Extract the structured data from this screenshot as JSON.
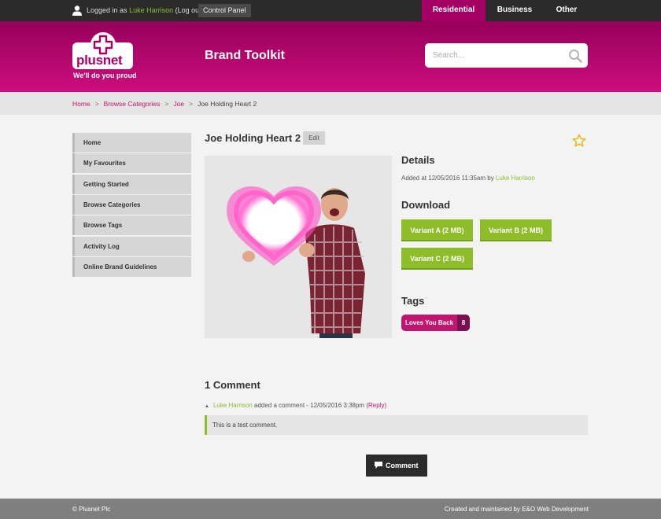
{
  "topbar": {
    "logged_in_prefix": "Logged in as",
    "username": "Luke Harrison",
    "logout": "(Log out)",
    "control_panel": "Control Panel",
    "nav": [
      "Residential",
      "Business",
      "Other"
    ],
    "active_nav": "Residential"
  },
  "header": {
    "logo_word": "plusnet",
    "logo_tagline": "We'll do you proud",
    "title": "Brand Toolkit",
    "search_placeholder": "Search..."
  },
  "breadcrumb": [
    "Home",
    "Browse Categories",
    "Joe",
    "Joe Holding Heart 2"
  ],
  "sidebar": {
    "items": [
      "Home",
      "My Favourites",
      "Getting Started",
      "Browse Categories",
      "Browse Tags",
      "Activity Log",
      "Online Brand Guidelines"
    ]
  },
  "asset": {
    "title": "Joe Holding Heart 2",
    "edit": "Edit"
  },
  "details": {
    "heading": "Details",
    "added_prefix": "Added at 12/05/2016 11:35am by",
    "added_by": "Luke Harrison"
  },
  "download": {
    "heading": "Download",
    "variants": [
      "Variant A (2 MB)",
      "Variant B (2 MB)",
      "Variant C (2 MB)"
    ]
  },
  "tags": {
    "heading": "Tags",
    "items": [
      {
        "label": "Loves You Back",
        "count": "8"
      }
    ]
  },
  "comments": {
    "heading": "1 Comment",
    "items": [
      {
        "author": "Luke Harrison",
        "meta": "added a comment - 12/05/2016 3:38pm",
        "reply": "(Reply)",
        "text": "This is a test comment."
      }
    ],
    "button": "Comment"
  },
  "footer": {
    "left": "© Plusnet Plc",
    "right": "Created and maintained by E&O Web Development"
  },
  "colors": {
    "brand": "#a40063",
    "green": "#8dbd28",
    "link_pink": "#c1166f",
    "dark": "#2b2b2b"
  }
}
